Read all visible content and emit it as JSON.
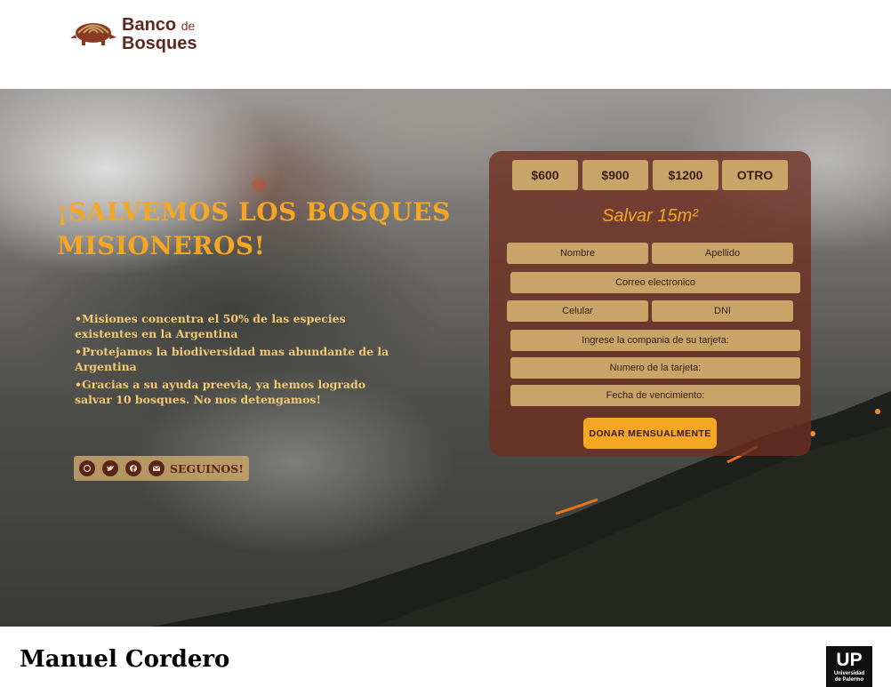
{
  "header": {
    "logo_line1": "Banco",
    "logo_line1_small": "de",
    "logo_line2": "Bosques"
  },
  "hero": {
    "headline": "¡SALVEMOS LOS BOSQUES MISIONEROS!",
    "bullets": [
      "•Misiones concentra el 50% de las especies existentes en la Argentina",
      "•Protejamos la biodiversidad mas abundante de la Argentina",
      "•Gracias a su ayuda preevia, ya hemos logrado salvar 10 bosques. No nos detengamos!"
    ],
    "social": {
      "icons": [
        "whatsapp-icon",
        "twitter-icon",
        "facebook-icon",
        "email-icon"
      ],
      "label": "SEGUINOS!"
    }
  },
  "form": {
    "amounts": [
      "$600",
      "$900",
      "$1200",
      "OTRO"
    ],
    "title": "Salvar 15m²",
    "fields": {
      "nombre": "Nombre",
      "apellido": "Apellido",
      "correo": "Correo electronico",
      "celular": "Celular",
      "dni": "DNI",
      "compania": "Ingrese la compania de su tarjeta:",
      "numero": "Numero de la tarjeta:",
      "vencimiento": "Fecha de vencimiento:"
    },
    "submit": "DONAR MENSUALMENTE"
  },
  "footer": {
    "author": "Manuel Cordero",
    "up_big": "UP",
    "up_small_1": "Universidad",
    "up_small_2": "de Palermo"
  },
  "colors": {
    "accent": "#f5a623",
    "field": "#c9a468",
    "panel": "#702e20",
    "brand_brown": "#5b2a1f"
  }
}
